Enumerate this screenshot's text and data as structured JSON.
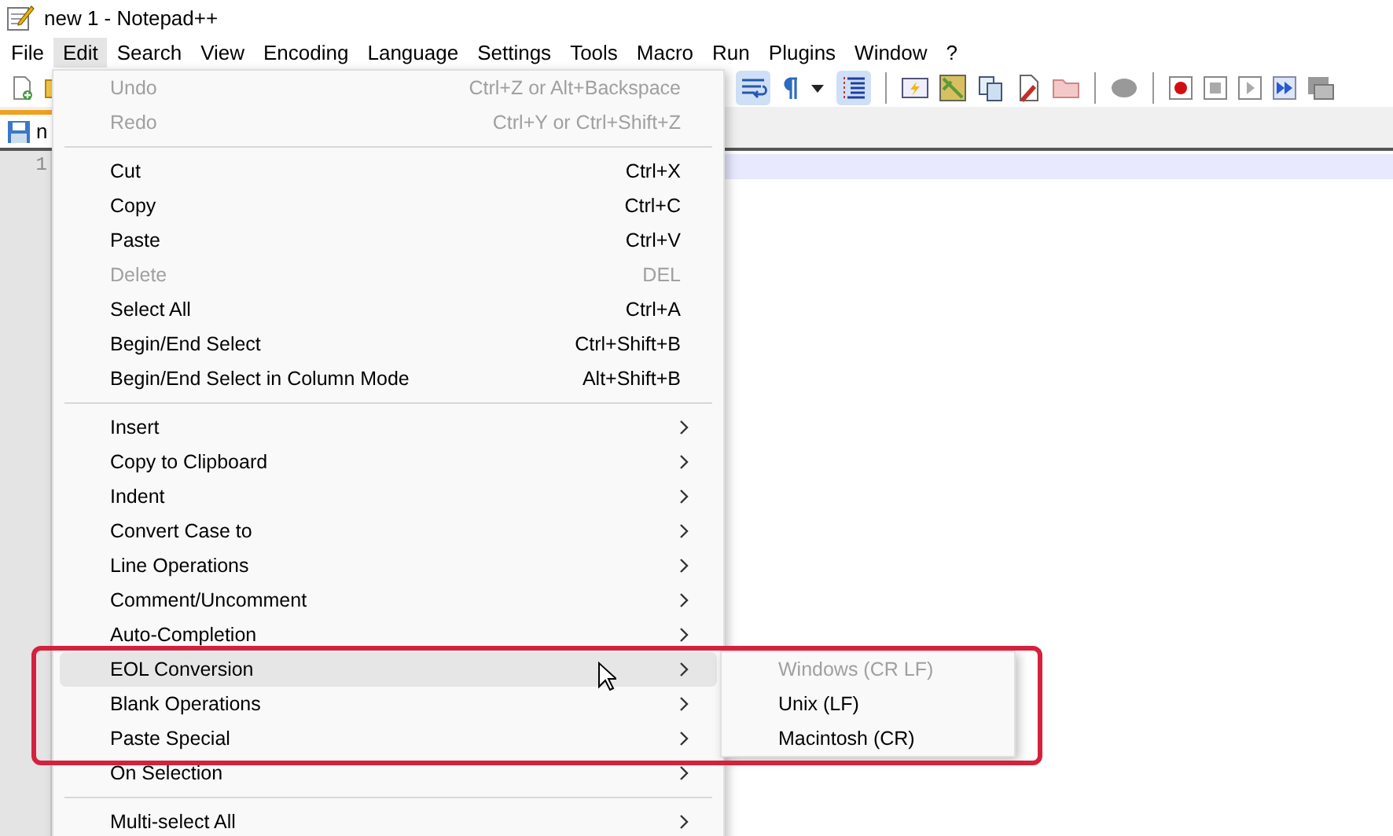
{
  "window": {
    "title": "new 1 - Notepad++"
  },
  "menubar": [
    {
      "label": "File",
      "selected": false
    },
    {
      "label": "Edit",
      "selected": true
    },
    {
      "label": "Search",
      "selected": false
    },
    {
      "label": "View",
      "selected": false
    },
    {
      "label": "Encoding",
      "selected": false
    },
    {
      "label": "Language",
      "selected": false
    },
    {
      "label": "Settings",
      "selected": false
    },
    {
      "label": "Tools",
      "selected": false
    },
    {
      "label": "Macro",
      "selected": false
    },
    {
      "label": "Run",
      "selected": false
    },
    {
      "label": "Plugins",
      "selected": false
    },
    {
      "label": "Window",
      "selected": false
    },
    {
      "label": "?",
      "selected": false
    }
  ],
  "tab": {
    "label": "n"
  },
  "editor": {
    "line_numbers": [
      "1"
    ]
  },
  "edit_menu": [
    {
      "kind": "command",
      "label": "Undo",
      "shortcut": "Ctrl+Z or Alt+Backspace",
      "disabled": true,
      "selected": false
    },
    {
      "kind": "command",
      "label": "Redo",
      "shortcut": "Ctrl+Y or Ctrl+Shift+Z",
      "disabled": true,
      "selected": false
    },
    {
      "kind": "separator"
    },
    {
      "kind": "command",
      "label": "Cut",
      "shortcut": "Ctrl+X",
      "disabled": false,
      "selected": false
    },
    {
      "kind": "command",
      "label": "Copy",
      "shortcut": "Ctrl+C",
      "disabled": false,
      "selected": false
    },
    {
      "kind": "command",
      "label": "Paste",
      "shortcut": "Ctrl+V",
      "disabled": false,
      "selected": false
    },
    {
      "kind": "command",
      "label": "Delete",
      "shortcut": "DEL",
      "disabled": true,
      "selected": false
    },
    {
      "kind": "command",
      "label": "Select All",
      "shortcut": "Ctrl+A",
      "disabled": false,
      "selected": false
    },
    {
      "kind": "command",
      "label": "Begin/End Select",
      "shortcut": "Ctrl+Shift+B",
      "disabled": false,
      "selected": false
    },
    {
      "kind": "command",
      "label": "Begin/End Select in Column Mode",
      "shortcut": "Alt+Shift+B",
      "disabled": false,
      "selected": false
    },
    {
      "kind": "separator"
    },
    {
      "kind": "submenu",
      "label": "Insert",
      "disabled": false,
      "selected": false
    },
    {
      "kind": "submenu",
      "label": "Copy to Clipboard",
      "disabled": false,
      "selected": false
    },
    {
      "kind": "submenu",
      "label": "Indent",
      "disabled": false,
      "selected": false
    },
    {
      "kind": "submenu",
      "label": "Convert Case to",
      "disabled": false,
      "selected": false
    },
    {
      "kind": "submenu",
      "label": "Line Operations",
      "disabled": false,
      "selected": false
    },
    {
      "kind": "submenu",
      "label": "Comment/Uncomment",
      "disabled": false,
      "selected": false
    },
    {
      "kind": "submenu",
      "label": "Auto-Completion",
      "disabled": false,
      "selected": false
    },
    {
      "kind": "submenu",
      "label": "EOL Conversion",
      "disabled": false,
      "selected": true
    },
    {
      "kind": "submenu",
      "label": "Blank Operations",
      "disabled": false,
      "selected": false
    },
    {
      "kind": "submenu",
      "label": "Paste Special",
      "disabled": false,
      "selected": false
    },
    {
      "kind": "submenu",
      "label": "On Selection",
      "disabled": false,
      "selected": false
    },
    {
      "kind": "separator"
    },
    {
      "kind": "submenu",
      "label": "Multi-select All",
      "disabled": false,
      "selected": false
    }
  ],
  "submenu": [
    {
      "label": "Windows (CR LF)",
      "disabled": true
    },
    {
      "label": "Unix (LF)",
      "disabled": false
    },
    {
      "label": "Macintosh (CR)",
      "disabled": false
    }
  ]
}
